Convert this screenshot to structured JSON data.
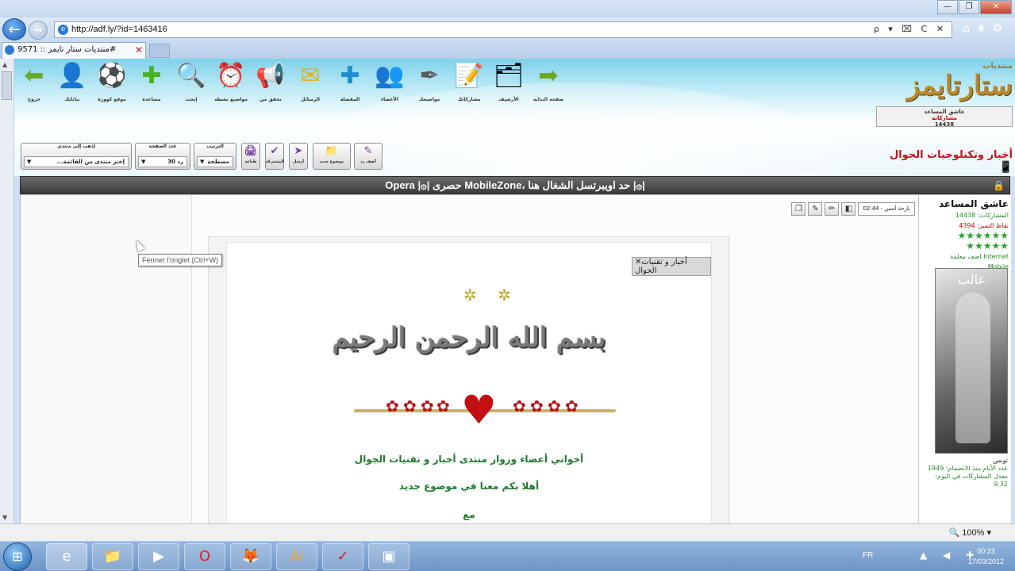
{
  "browser": {
    "url": "http://adf.ly/?id=1463416",
    "tab_title": "منتديات ستار تايمز :: 9571#",
    "address_controls": "ρ ▾ ⌧ C ✕",
    "zoom": "100%",
    "window_buttons": [
      "—",
      "❐",
      "✕"
    ],
    "nav_icons": [
      "⌂",
      "★",
      "⚙"
    ]
  },
  "header": {
    "logo_small": "منتديات",
    "logo_big": "ستارتايمز",
    "user_line1": "عاشق المساعد",
    "user_line2": "مشاركاته",
    "user_line3": "14438",
    "section_title": "أخبار وتكنلوجيات الجوال",
    "top_icons": [
      {
        "label": "خروج",
        "icon": "⬅",
        "color": "#6aa82a"
      },
      {
        "label": "بياناتك",
        "icon": "👤",
        "color": "#b33"
      },
      {
        "label": "موقع كوورة",
        "icon": "⚽",
        "color": "#111"
      },
      {
        "label": "مساعدة",
        "icon": "✚",
        "color": "#4caf2c"
      },
      {
        "label": "إبحث",
        "icon": "🔍",
        "color": "#2a6fb0"
      },
      {
        "label": "مواضيع نشطة",
        "icon": "⏰",
        "color": "#e08a12"
      },
      {
        "label": "تحقق من",
        "icon": "📢",
        "color": "#b58a2a"
      },
      {
        "label": "الرسائل",
        "icon": "✉",
        "color": "#e6b312"
      },
      {
        "label": "المفضلة",
        "icon": "✚",
        "color": "#1f8fd4"
      },
      {
        "label": "الأعضاء",
        "icon": "👥",
        "color": "#2a9acb"
      },
      {
        "label": "مواضيعك",
        "icon": "✒",
        "color": "#5b5b5b"
      },
      {
        "label": "مشاركاتك",
        "icon": "📝",
        "color": "#777"
      },
      {
        "label": "الأرشيف",
        "icon": "🗂",
        "color": "#4a7fb0"
      },
      {
        "label": "صفحة البداية",
        "icon": "➡",
        "color": "#6aa82a"
      }
    ],
    "controls": {
      "goto_label": "إذهب إلى منتدى",
      "goto_value": "...إختر منتدى من القائمة",
      "perpage_label": "عدد الصفحة",
      "perpage_value": "30 رد",
      "order_label": "الترتيب",
      "order_value": "مسطحة",
      "buttons": [
        {
          "label": "طباعة",
          "icon": "🖨"
        },
        {
          "label": "المشتركة",
          "icon": "✔"
        },
        {
          "label": "أرسل",
          "icon": "➤"
        },
        {
          "label": "موضوع جديد",
          "icon": "📁"
        },
        {
          "label": "أضف رد",
          "icon": "✎"
        }
      ]
    }
  },
  "thread": {
    "title": "Opera |۞| حصرى MobileZone، حد اويبرتسل الشغال هنا |۞|"
  },
  "post": {
    "date": "02:44 - بارحة أمس",
    "tag": "أخبار و تقنيات الجوال",
    "basmala": "بسم الله الرحمن الرحيم",
    "line1": "أخواني أعضاء وزوار منتدى أخبار و تقنيات الجوال",
    "line2": "أهلا بكم معنا في موضوع جديد",
    "line3": "مع",
    "stars": "✲ ✲"
  },
  "user": {
    "name": "عاشق المساعد",
    "posts_label": "المشاركات:",
    "posts": "14438",
    "points_label": "نقاط التميز:",
    "points": "4394",
    "rating": "★★★★★★",
    "rating2": "★★★★★",
    "desc1": "اضف معلمة Internet",
    "desc2": "Mobile",
    "avatar_name": "غالب",
    "country": "تونس",
    "since": "عدد الأيام منذ الانضمام: 1949",
    "avg": "معدل المشاركات في اليوم: 9.32"
  },
  "tooltip": "Fermer l'onglet (Ctrl+W)",
  "taskbar": {
    "apps": [
      "e",
      "📁",
      "▶",
      "O",
      "🦊",
      "Ai",
      "✓",
      "▣"
    ],
    "lang": "FR",
    "tray_icons": "▲ ◀ ✚",
    "time": "00:23",
    "date": "17/03/2012"
  }
}
